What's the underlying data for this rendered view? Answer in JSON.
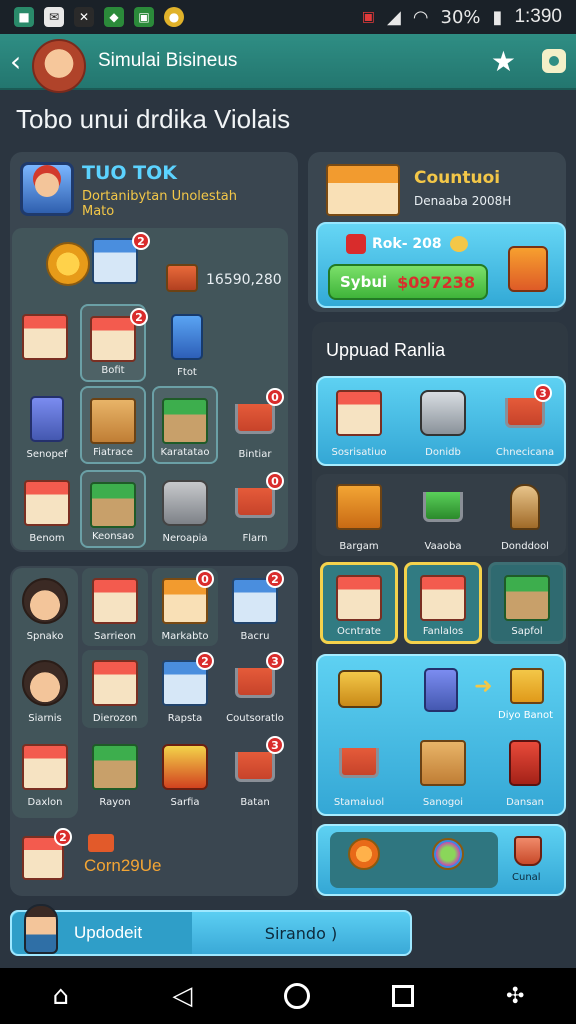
{
  "status_bar": {
    "battery": "30%",
    "time": "1:390"
  },
  "app_bar": {
    "title": "Simulai Bisineus"
  },
  "page_title": "Tobo unui drdika Violais",
  "profile": {
    "name": "TUO TOK",
    "line1": "Dortanibytan Unolestah",
    "line2": "Mato",
    "money": "16590,280"
  },
  "left_grid": [
    {
      "label": "Bofit",
      "badge": ""
    },
    {
      "label": "Ftot",
      "badge": ""
    },
    {
      "label": "Senopef",
      "badge": ""
    },
    {
      "label": "Fiatrace",
      "badge": ""
    },
    {
      "label": "Karatatao",
      "badge": ""
    },
    {
      "label": "Bintiar",
      "badge": "0"
    },
    {
      "label": "Benom",
      "badge": ""
    },
    {
      "label": "Keonsao",
      "badge": ""
    },
    {
      "label": "Neroapia",
      "badge": ""
    },
    {
      "label": "Flarn",
      "badge": "0"
    }
  ],
  "left_badges": {
    "shop_top": "2",
    "stall": "2"
  },
  "left_grid2": [
    {
      "label": "Spnako",
      "badge": ""
    },
    {
      "label": "Sarrieon",
      "badge": ""
    },
    {
      "label": "Markabto",
      "badge": "0"
    },
    {
      "label": "Bacru",
      "badge": "2"
    },
    {
      "label": "Siarnis",
      "badge": ""
    },
    {
      "label": "Dierozon",
      "badge": ""
    },
    {
      "label": "Rapsta",
      "badge": "2"
    },
    {
      "label": "Coutsoratlo",
      "badge": "3"
    },
    {
      "label": "Daxlon",
      "badge": ""
    },
    {
      "label": "Rayon",
      "badge": ""
    },
    {
      "label": "Sarfia",
      "badge": ""
    },
    {
      "label": "Batan",
      "badge": "3"
    }
  ],
  "combo": {
    "text": "Corn29Ue",
    "badge": "2"
  },
  "right_top": {
    "title": "Countuoi",
    "subtitle": "Denaaba 2008H"
  },
  "right_card": {
    "label": "Rok- 208",
    "pill_label": "Sybui",
    "pill_value": "$097238"
  },
  "upgrade_title": "Uppuad Ranlia",
  "upgrade_row1": [
    {
      "label": "Sosrisatiuo",
      "badge": ""
    },
    {
      "label": "Donidb",
      "badge": ""
    },
    {
      "label": "Chnecicana",
      "badge": "3"
    }
  ],
  "upgrade_row2": [
    {
      "label": "Bargam"
    },
    {
      "label": "Vaaoba"
    },
    {
      "label": "Donddool"
    }
  ],
  "upgrade_row3": [
    {
      "label": "Ocntrate"
    },
    {
      "label": "Fanlalos"
    },
    {
      "label": "Sapfol"
    }
  ],
  "upgrade_row4": [
    {
      "label": "Stamaiuol"
    },
    {
      "label": "Sanogoi"
    },
    {
      "label": "Dansan"
    }
  ],
  "upgrade_row4_extra": "Diyo Banot",
  "bottom_right": {
    "label": "Cunal"
  },
  "footer": {
    "left": "Updodeit",
    "right": "Sirando )"
  }
}
